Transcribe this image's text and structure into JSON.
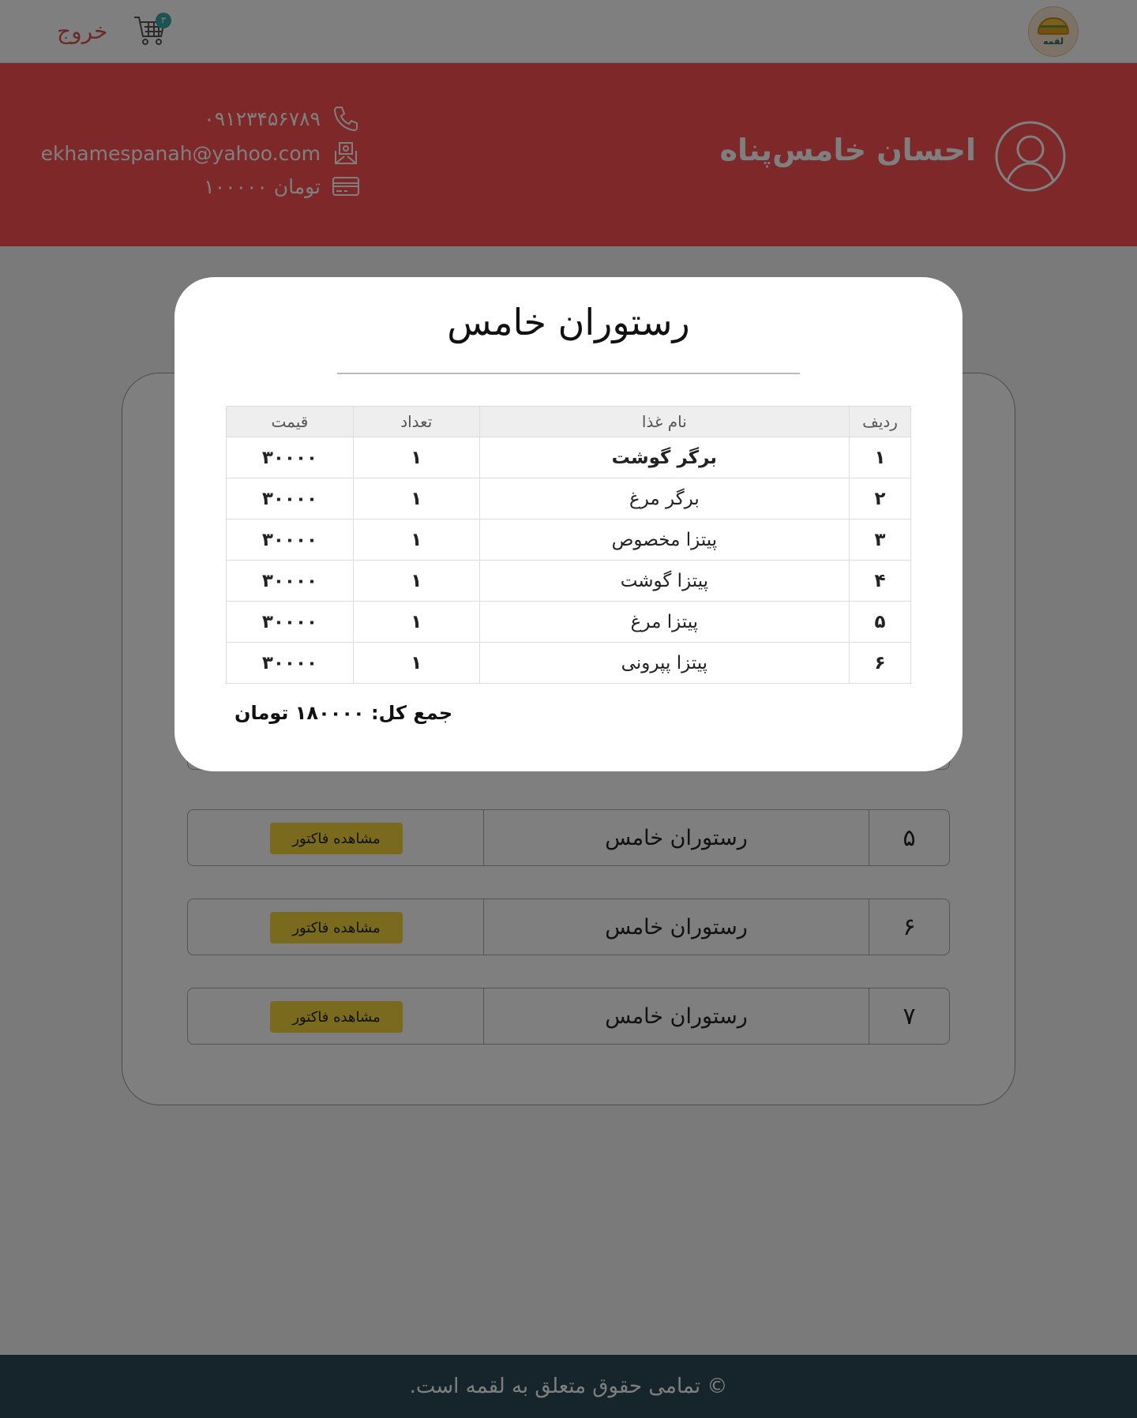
{
  "nav": {
    "logo_text": "لقمه",
    "cart_count": "۳",
    "logout_label": "خروج"
  },
  "profile": {
    "name": "احسان خامس‌پناه",
    "phone": "۰۹۱۲۳۴۵۶۷۸۹",
    "email": "ekhamespanah@yahoo.com",
    "credit": "۱۰۰۰۰۰ تومان"
  },
  "orders": [
    {
      "num": "۵",
      "restaurant": "رستوران خامس",
      "button": "مشاهده فاکتور"
    },
    {
      "num": "۶",
      "restaurant": "رستوران خامس",
      "button": "مشاهده فاکتور"
    },
    {
      "num": "۷",
      "restaurant": "رستوران خامس",
      "button": "مشاهده فاکتور"
    }
  ],
  "modal": {
    "title": "رستوران خامس",
    "headers": {
      "row": "ردیف",
      "name": "نام غذا",
      "qty": "تعداد",
      "price": "قیمت"
    },
    "items": [
      {
        "row": "۱",
        "name": "برگر گوشت",
        "qty": "۱",
        "price": "۳۰۰۰۰"
      },
      {
        "row": "۲",
        "name": "برگر مرغ",
        "qty": "۱",
        "price": "۳۰۰۰۰"
      },
      {
        "row": "۳",
        "name": "پیتزا مخصوص",
        "qty": "۱",
        "price": "۳۰۰۰۰"
      },
      {
        "row": "۴",
        "name": "پیتزا گوشت",
        "qty": "۱",
        "price": "۳۰۰۰۰"
      },
      {
        "row": "۵",
        "name": "پیتزا مرغ",
        "qty": "۱",
        "price": "۳۰۰۰۰"
      },
      {
        "row": "۶",
        "name": "پیتزا پپرونی",
        "qty": "۱",
        "price": "۳۰۰۰۰"
      }
    ],
    "total": "جمع کل: ۱۸۰۰۰۰ تومان"
  },
  "footer": {
    "text": "© تمامی حقوق متعلق به لقمه است."
  },
  "colors": {
    "profile_bg": "#fe5054",
    "button_bg": "#f5d43a",
    "footer_bg": "#2a4b56",
    "badge_bg": "#3aa7a5",
    "logout": "#d9534f"
  }
}
